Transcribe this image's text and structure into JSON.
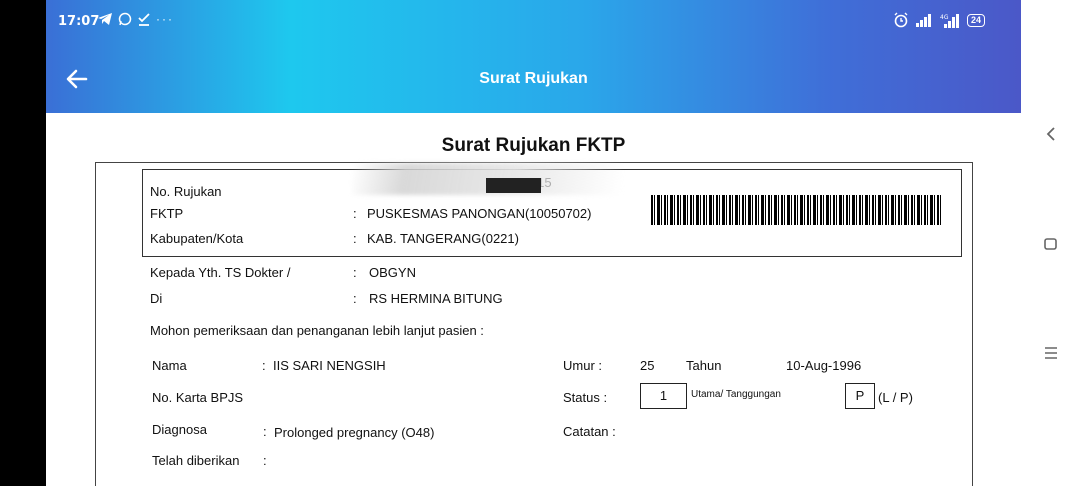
{
  "status_bar": {
    "time": "17:07",
    "battery": "24"
  },
  "app_bar": {
    "title": "Surat Rujukan"
  },
  "document": {
    "title": "Surat Rujukan FKTP",
    "header_block": {
      "no_rujukan_label": "No. Rujukan",
      "no_rujukan_value": "1093815",
      "fktp_label": "FKTP",
      "fktp_value": "PUSKESMAS PANONGAN(10050702)",
      "kabupaten_label": "Kabupaten/Kota",
      "kabupaten_value": "KAB. TANGERANG(0221)"
    },
    "kepada_label": "Kepada Yth.  TS Dokter /",
    "kepada_value": "OBGYN",
    "di_label": "Di",
    "di_value": "RS HERMINA BITUNG",
    "intro": "Mohon pemeriksaan dan penanganan lebih lanjut pasien :",
    "nama_label": "Nama",
    "nama_value": "IIS SARI NENGSIH",
    "umur_label": "Umur :",
    "umur_value": "25",
    "umur_unit": "Tahun",
    "birth_date": "10-Aug-1996",
    "kartu_label": "No. Karta BPJS",
    "status_label": "Status :",
    "status_value": "1",
    "status_desc": "Utama/ Tanggungan",
    "gender_value": "P",
    "gender_options": "(L / P)",
    "diagnosa_label": "Diagnosa",
    "diagnosa_value": "Prolonged pregnancy (O48)",
    "catatan_label": "Catatan :",
    "diberikan_label": "Telah diberikan"
  },
  "colors": {
    "header_start": "#3a6fd6",
    "header_mid": "#1ec8ee",
    "header_end": "#4b58c8"
  }
}
